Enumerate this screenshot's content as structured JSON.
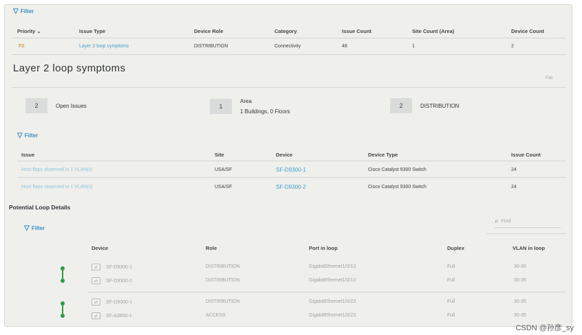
{
  "filter_label": "Filter",
  "issues_table": {
    "headers": [
      "Priority",
      "Issue Type",
      "Device Role",
      "Category",
      "Issue Count",
      "Site Count (Area)",
      "Device Count"
    ],
    "sort_indicator": "⌄",
    "row": {
      "priority": "P2",
      "issue_type": "Layer 2 loop symptoms",
      "device_role": "DISTRIBUTION",
      "category": "Connectivity",
      "issue_count": "48",
      "site_count": "1",
      "device_count": "2"
    }
  },
  "detail": {
    "title": "Layer 2 loop symptoms",
    "corner_label": "Fab",
    "summary": [
      {
        "count": "2",
        "label": "Open Issues"
      },
      {
        "count": "1",
        "label_top": "Area",
        "label": "1 Buildings, 0 Floors"
      },
      {
        "count": "2",
        "label": "DISTRIBUTION"
      }
    ]
  },
  "issue_list": {
    "headers": [
      "Issue",
      "Site",
      "Device",
      "Device Type",
      "Issue Count"
    ],
    "rows": [
      {
        "issue": "Host flaps observed in 1 VLAN(s)",
        "site": "USA/SF",
        "device": "SF-D9300-1",
        "device_type": "Cisco Catalyst 9300 Switch",
        "count": "24"
      },
      {
        "issue": "Host flaps observed in 1 VLAN(s)",
        "site": "USA/SF",
        "device": "SF-D9300-2",
        "device_type": "Cisco Catalyst 9300 Switch",
        "count": "24"
      }
    ]
  },
  "loop_details": {
    "title": "Potential Loop Details",
    "search_placeholder": "Find",
    "headers": [
      "Device",
      "Role",
      "Port in loop",
      "Duplex",
      "VLAN in loop"
    ],
    "rows": [
      {
        "device": "SF-D9300-1",
        "role": "DISTRIBUTION",
        "port": "GigabitEthernet1/0/13",
        "duplex": "Full",
        "vlan": "30-35"
      },
      {
        "device": "SF-D9300-2",
        "role": "DISTRIBUTION",
        "port": "GigabitEthernet1/0/13",
        "duplex": "Full",
        "vlan": "30-35"
      },
      {
        "device": "SF-D9300-1",
        "role": "DISTRIBUTION",
        "port": "GigabitEthernet1/0/23",
        "duplex": "Full",
        "vlan": "30-35"
      },
      {
        "device": "SF-A3850-1",
        "role": "ACCESS",
        "port": "GigabitEthernet1/0/23",
        "duplex": "Full",
        "vlan": "30-35"
      }
    ]
  },
  "watermark": "CSDN @孙彦_sy",
  "colors": {
    "link": "#45a0c9",
    "loop_indicator": "#2e9b48",
    "priority": "#c9a24a"
  }
}
